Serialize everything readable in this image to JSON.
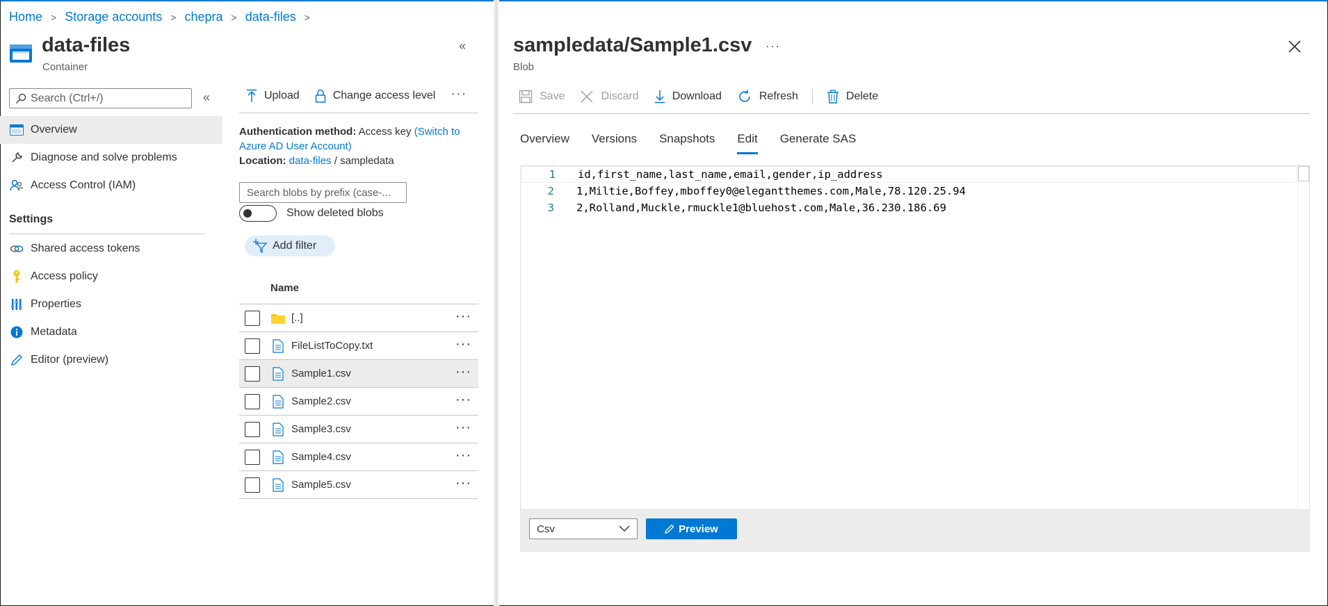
{
  "breadcrumb": [
    "Home",
    "Storage accounts",
    "chepra",
    "data-files"
  ],
  "left_blade": {
    "title": "data-files",
    "subtitle": "Container",
    "search_placeholder": "Search (Ctrl+/)",
    "nav": [
      {
        "label": "Overview",
        "icon": "overview-icon",
        "active": true
      },
      {
        "label": "Diagnose and solve problems",
        "icon": "wrench-icon"
      },
      {
        "label": "Access Control (IAM)",
        "icon": "people-icon"
      }
    ],
    "settings_label": "Settings",
    "settings_nav": [
      {
        "label": "Shared access tokens",
        "icon": "link-icon"
      },
      {
        "label": "Access policy",
        "icon": "key-icon"
      },
      {
        "label": "Properties",
        "icon": "properties-icon"
      },
      {
        "label": "Metadata",
        "icon": "info-icon"
      },
      {
        "label": "Editor (preview)",
        "icon": "pencil-icon"
      }
    ]
  },
  "middle": {
    "toolbar": {
      "upload": "Upload",
      "change_access": "Change access level",
      "more": "···"
    },
    "auth_label": "Authentication method:",
    "auth_value": "Access key",
    "auth_link": "(Switch to Azure AD User Account)",
    "location_label": "Location:",
    "location_link": "data-files",
    "location_sep": "/",
    "location_value": "sampledata",
    "blob_search_placeholder": "Search blobs by prefix (case-...",
    "show_deleted": "Show deleted blobs",
    "add_filter": "Add filter",
    "column_name": "Name",
    "rows": [
      {
        "name": "[..]",
        "type": "folder"
      },
      {
        "name": "FileListToCopy.txt",
        "type": "file"
      },
      {
        "name": "Sample1.csv",
        "type": "file",
        "selected": true
      },
      {
        "name": "Sample2.csv",
        "type": "file"
      },
      {
        "name": "Sample3.csv",
        "type": "file"
      },
      {
        "name": "Sample4.csv",
        "type": "file"
      },
      {
        "name": "Sample5.csv",
        "type": "file"
      }
    ]
  },
  "right_blade": {
    "title": "sampledata/Sample1.csv",
    "more": "···",
    "subtitle": "Blob",
    "toolbar": {
      "save": "Save",
      "discard": "Discard",
      "download": "Download",
      "refresh": "Refresh",
      "delete": "Delete"
    },
    "tabs": [
      "Overview",
      "Versions",
      "Snapshots",
      "Edit",
      "Generate SAS"
    ],
    "active_tab": "Edit",
    "code_lines": [
      {
        "n": "1",
        "text": "id,first_name,last_name,email,gender,ip_address"
      },
      {
        "n": "2",
        "text": "1,Miltie,Boffey,mboffey0@elegantthemes.com,Male,78.120.25.94"
      },
      {
        "n": "3",
        "text": "2,Rolland,Muckle,rmuckle1@bluehost.com,Male,36.230.186.69"
      }
    ],
    "format_value": "Csv",
    "preview_label": "Preview"
  },
  "colors": {
    "accent": "#0078d4",
    "selected_row": "#ececec",
    "folder": "#f2c811"
  }
}
